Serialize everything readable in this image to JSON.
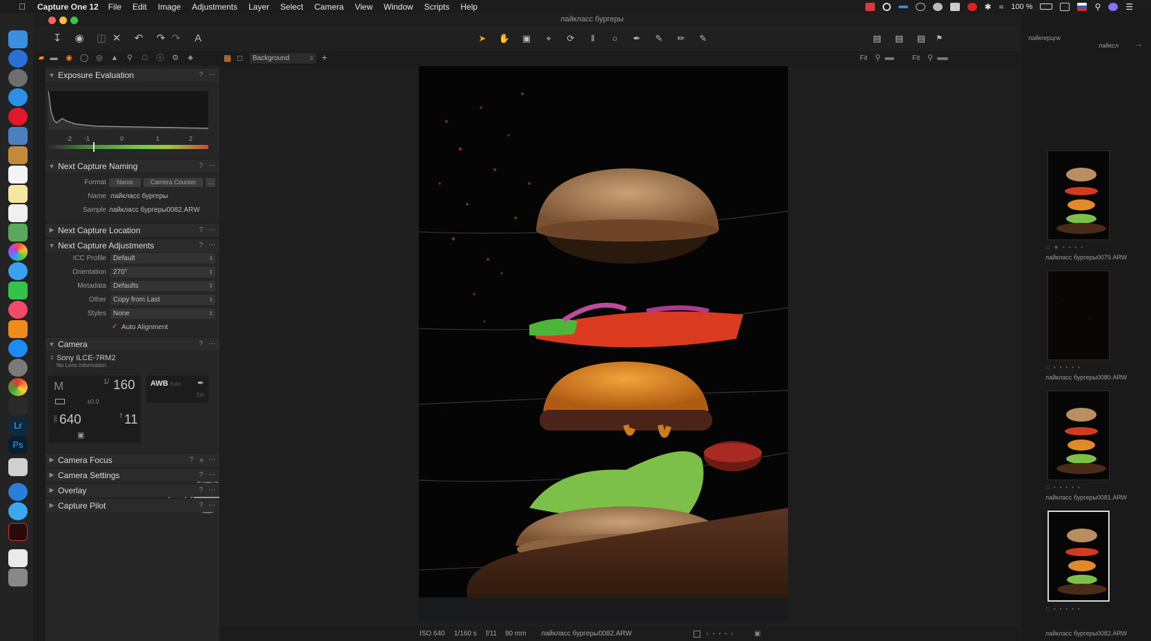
{
  "menubar": {
    "app": "Capture One 12",
    "items": [
      "File",
      "Edit",
      "Image",
      "Adjustments",
      "Layer",
      "Select",
      "Camera",
      "View",
      "Window",
      "Scripts",
      "Help"
    ],
    "battery": "100 %",
    "status_colors": {
      "adobe": "#d9363e",
      "opera": "#e02020"
    }
  },
  "window": {
    "title": "лайкласс бургеры",
    "traffic_colors": [
      "#fc605c",
      "#fdbc40",
      "#34c84a"
    ]
  },
  "toolbar": {
    "left_icons": [
      "import-icon",
      "camera-icon",
      "export-icon",
      "delete-icon",
      "undo-icon",
      "redo-icon",
      "reset-icon",
      "text-icon"
    ],
    "cursor_tools": [
      "select-cursor-icon",
      "pan-icon",
      "capture-icon",
      "crop-icon",
      "rotate-icon",
      "keystone-icon",
      "circle-icon",
      "picker-icon",
      "brush-icon",
      "eraser-icon",
      "gradient-icon"
    ],
    "right_icons": [
      "layout-1-icon",
      "layout-2-icon",
      "layout-3-icon",
      "bookmark-icon"
    ]
  },
  "viewer_toolbar": {
    "background_select": "Background",
    "fit_left": "Fit",
    "fit_right": "Fit",
    "right_label": "лайкcл"
  },
  "browser_header": "лайкгерцrw",
  "panel": {
    "exposure": {
      "title": "Exposure Evaluation",
      "scale": [
        "-2",
        "-1",
        "0",
        "1",
        "2"
      ]
    },
    "naming": {
      "title": "Next Capture Naming",
      "format_label": "Format",
      "format_tokens": [
        "Name",
        "Camera Counter",
        "..."
      ],
      "name_label": "Name",
      "name_value": "лайкласс бургеры",
      "sample_label": "Sample",
      "sample_value": "лайкласс бургеры0082.ARW"
    },
    "location": {
      "title": "Next Capture Location"
    },
    "adjustments": {
      "title": "Next Capture Adjustments",
      "rows": [
        {
          "label": "ICC Profile",
          "value": "Default"
        },
        {
          "label": "Orientation",
          "value": "270°"
        },
        {
          "label": "Metadata",
          "value": "Defaults"
        },
        {
          "label": "Other",
          "value": "Copy from Last"
        },
        {
          "label": "Styles",
          "value": "None"
        }
      ],
      "auto_alignment": "Auto Alignment",
      "auto_alignment_checked": true
    },
    "camera": {
      "title": "Camera",
      "model": "Sony ILCE-7RM2",
      "lens": "No Lens Information",
      "mode": "M",
      "shutter": "160",
      "shutter_prefix": "1/",
      "exposure_comp": "±0.0",
      "iso": "640",
      "iso_prefix": "ISO",
      "aperture": "11",
      "aperture_prefix": "f",
      "wb": "AWB",
      "wb_sub": "Auto",
      "set_label": "Set"
    },
    "collapsed": [
      {
        "title": "Camera Focus"
      },
      {
        "title": "Camera Settings"
      },
      {
        "title": "Overlay"
      },
      {
        "title": "Capture Pilot"
      }
    ]
  },
  "status": {
    "iso": "ISO 640",
    "shutter": "1/160 s",
    "aperture": "f/11",
    "focal": "90 mm",
    "filename": "лайкласс бургеры0082.ARW"
  },
  "thumbnails": [
    {
      "filename": "лайкласс бургеры0079.ARW",
      "rating": 1,
      "selected": false
    },
    {
      "filename": "лайкласс бургеры0080.ARW",
      "rating": 0,
      "selected": false
    },
    {
      "filename": "лайкласс бургеры0081.ARW",
      "rating": 0,
      "selected": false
    },
    {
      "filename": "лайкласс бургеры0082.ARW",
      "rating": 0,
      "selected": true
    }
  ]
}
